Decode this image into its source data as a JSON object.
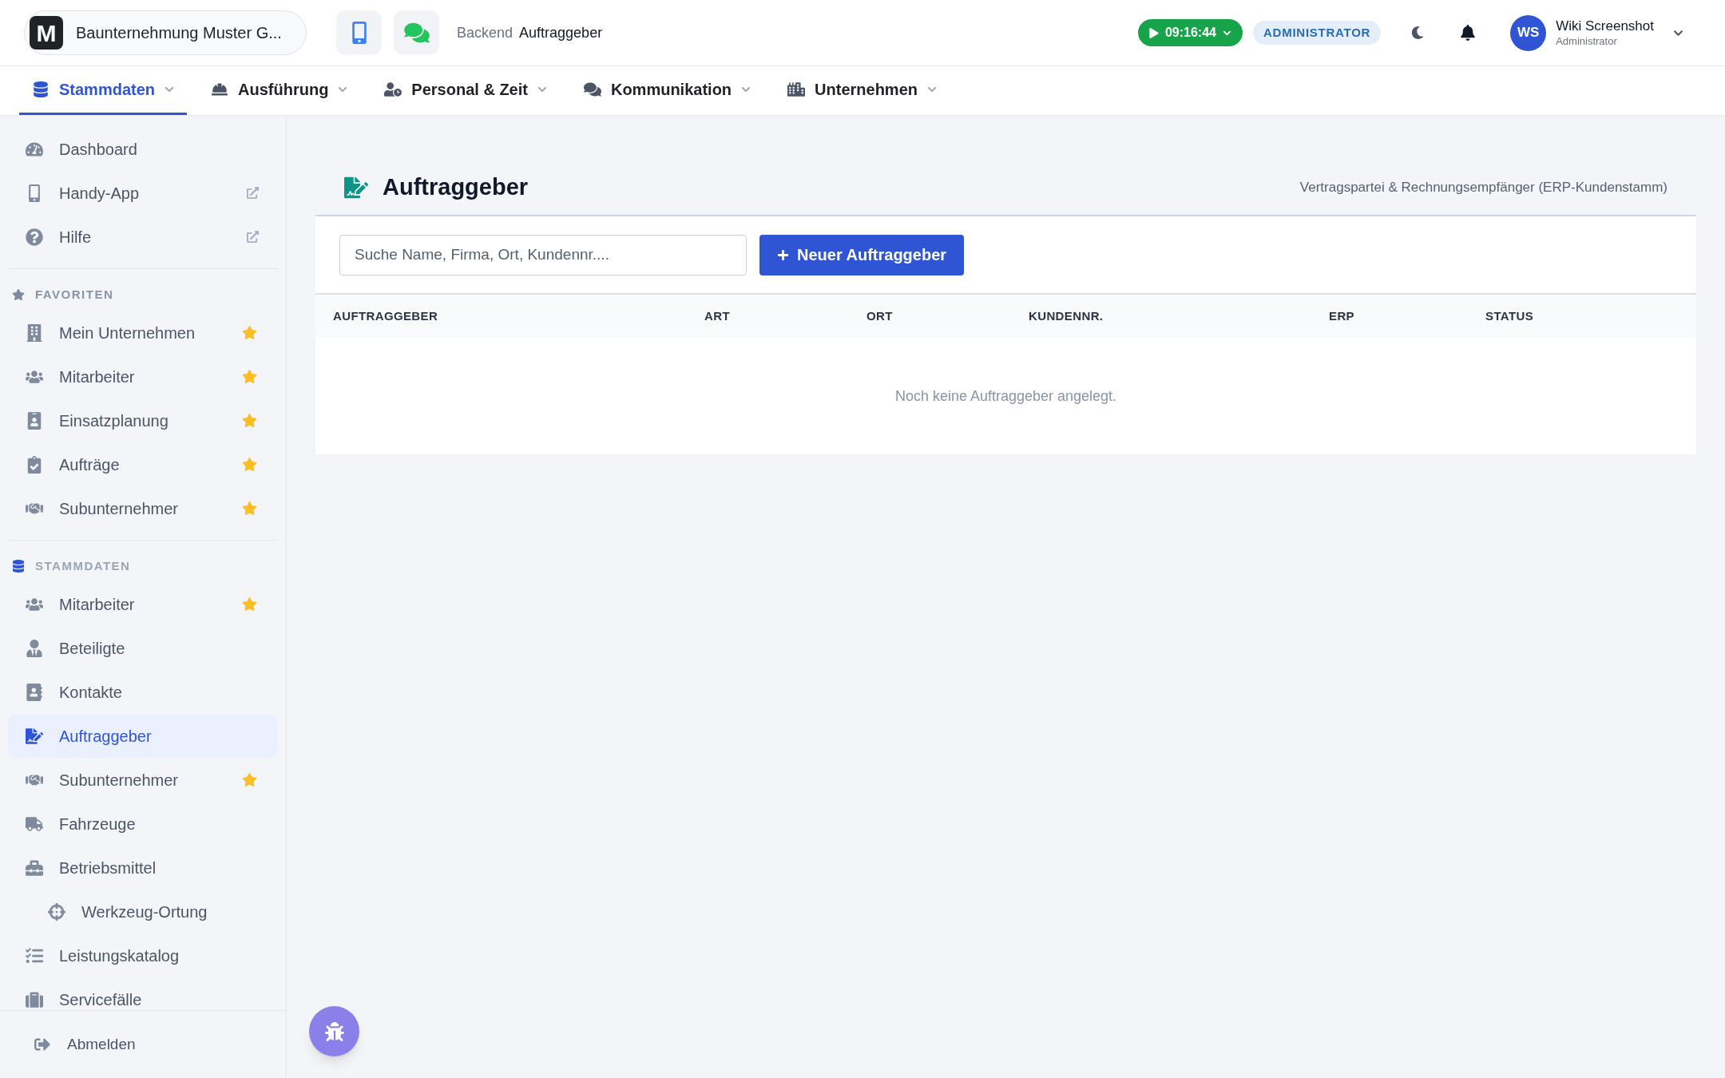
{
  "company": {
    "logo_letter": "M",
    "name": "Baunternehmung Muster G..."
  },
  "breadcrumb": {
    "section": "Backend",
    "page": "Auftraggeber"
  },
  "timer": {
    "time": "09:16:44"
  },
  "role_badge": "ADMINISTRATOR",
  "user": {
    "initials": "WS",
    "name": "Wiki Screenshot",
    "role": "Administrator"
  },
  "nav_tabs": [
    {
      "label": "Stammdaten",
      "selected": true
    },
    {
      "label": "Ausführung",
      "selected": false
    },
    {
      "label": "Personal & Zeit",
      "selected": false
    },
    {
      "label": "Kommunikation",
      "selected": false
    },
    {
      "label": "Unternehmen",
      "selected": false
    }
  ],
  "sidebar": {
    "top_items": [
      {
        "label": "Dashboard",
        "external": false
      },
      {
        "label": "Handy-App",
        "external": true
      },
      {
        "label": "Hilfe",
        "external": true
      }
    ],
    "favorites": {
      "title": "FAVORITEN",
      "items": [
        {
          "label": "Mein Unternehmen",
          "favorite": true
        },
        {
          "label": "Mitarbeiter",
          "favorite": true
        },
        {
          "label": "Einsatzplanung",
          "favorite": true
        },
        {
          "label": "Aufträge",
          "favorite": true
        },
        {
          "label": "Subunternehmer",
          "favorite": true
        }
      ]
    },
    "stammdaten": {
      "title": "STAMMDATEN",
      "items": [
        {
          "label": "Mitarbeiter",
          "favorite": true,
          "selected": false
        },
        {
          "label": "Beteiligte",
          "favorite": false,
          "selected": false
        },
        {
          "label": "Kontakte",
          "favorite": false,
          "selected": false
        },
        {
          "label": "Auftraggeber",
          "favorite": false,
          "selected": true
        },
        {
          "label": "Subunternehmer",
          "favorite": true,
          "selected": false
        },
        {
          "label": "Fahrzeuge",
          "favorite": false,
          "selected": false
        },
        {
          "label": "Betriebsmittel",
          "favorite": false,
          "selected": false,
          "children": [
            {
              "label": "Werkzeug-Ortung",
              "favorite": false,
              "selected": false
            }
          ]
        },
        {
          "label": "Leistungskatalog",
          "favorite": false,
          "selected": false
        },
        {
          "label": "Servicefälle",
          "favorite": false,
          "selected": false
        }
      ]
    },
    "footer": "Abmelden"
  },
  "page": {
    "title": "Auftraggeber",
    "subtitle": "Vertragspartei & Rechnungsempfänger (ERP-Kundenstamm)",
    "search": {
      "placeholder": "Suche Name, Firma, Ort, Kundennr...."
    },
    "new_button": "Neuer Auftraggeber",
    "table": {
      "columns": [
        "AUFTRAGGEBER",
        "ART",
        "ORT",
        "KUNDENNR.",
        "ERP",
        "STATUS"
      ],
      "empty_message": "Noch keine Auftraggeber angelegt."
    }
  }
}
